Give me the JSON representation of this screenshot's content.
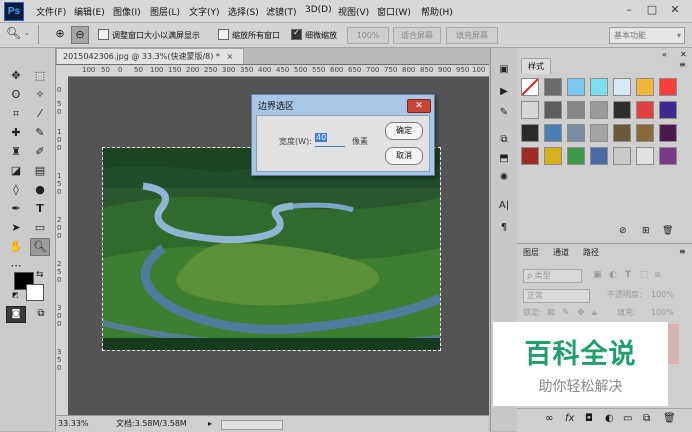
{
  "app": {
    "logo": "Ps"
  },
  "menubar": {
    "items": [
      "文件(F)",
      "编辑(E)",
      "图像(I)",
      "图层(L)",
      "文字(Y)",
      "选择(S)",
      "滤镜(T)",
      "3D(D)",
      "视图(V)",
      "窗口(W)",
      "帮助(H)"
    ],
    "minimize": "–",
    "restore": "□",
    "close": "✕"
  },
  "options": {
    "resize_windows": "调整窗口大小以满屏显示",
    "zoom_all_windows": "缩放所有窗口",
    "scrubby_zoom": "细微缩放",
    "zoom_value": "100%",
    "fit_screen": "适合屏幕",
    "fill_screen": "填充屏幕",
    "workspace": "基本功能"
  },
  "document": {
    "tab_title": "2015042306.jpg @ 33.3%(快速蒙版/8) *",
    "tab_close": "×",
    "ruler_h": [
      "100",
      "50",
      "0",
      "50",
      "100",
      "150",
      "200",
      "250",
      "300",
      "350",
      "400",
      "450",
      "500",
      "550",
      "600",
      "650",
      "700",
      "750",
      "800",
      "850",
      "900",
      "950",
      "100"
    ],
    "ruler_v": [
      "0",
      "5",
      "0",
      "1",
      "0",
      "0",
      "1",
      "5",
      "0",
      "2",
      "0",
      "0",
      "2",
      "5",
      "0",
      "3",
      "0",
      "0",
      "3",
      "5",
      "0"
    ]
  },
  "status": {
    "zoom": "33.33%",
    "doc_size": "文档:3.58M/3.58M"
  },
  "dialog": {
    "title": "边界选区",
    "width_label": "宽度(W):",
    "width_value": "40",
    "unit": "像素",
    "ok": "确定",
    "cancel": "取消"
  },
  "styles_panel": {
    "tab": "样式",
    "swatches": [
      "#ffffff",
      "#6b6b6b",
      "#7cc8ee",
      "#7ae0f0",
      "#d7e9f5",
      "#f2b63a",
      "#ff3d3d",
      "#d6d6d6",
      "#5e5e5e",
      "#858585",
      "#9a9a9a",
      "#2e2e2e",
      "#e04040",
      "#3d2a8c",
      "#2a2a2a",
      "#4c7db5",
      "#7a8c9e",
      "#a3a3a3",
      "#6a5a3a",
      "#8a6a3a",
      "#4a1a4a",
      "#a02a2a",
      "#d6b21a",
      "#3a9a4a",
      "#4a6aa8",
      "#c9c9c9",
      "#e0e0e0",
      "#7a3a8a"
    ]
  },
  "layers_panel": {
    "tabs": [
      "图层",
      "通道",
      "路径"
    ],
    "kind": "ρ 类型",
    "blend_mode": "正常",
    "opacity_label": "不透明度:",
    "opacity_value": "100%",
    "lock_label": "锁定:",
    "fill_label": "填充:",
    "fill_value": "100%"
  },
  "watermark": {
    "title": "百科全说",
    "subtitle": "助你轻松解决"
  }
}
